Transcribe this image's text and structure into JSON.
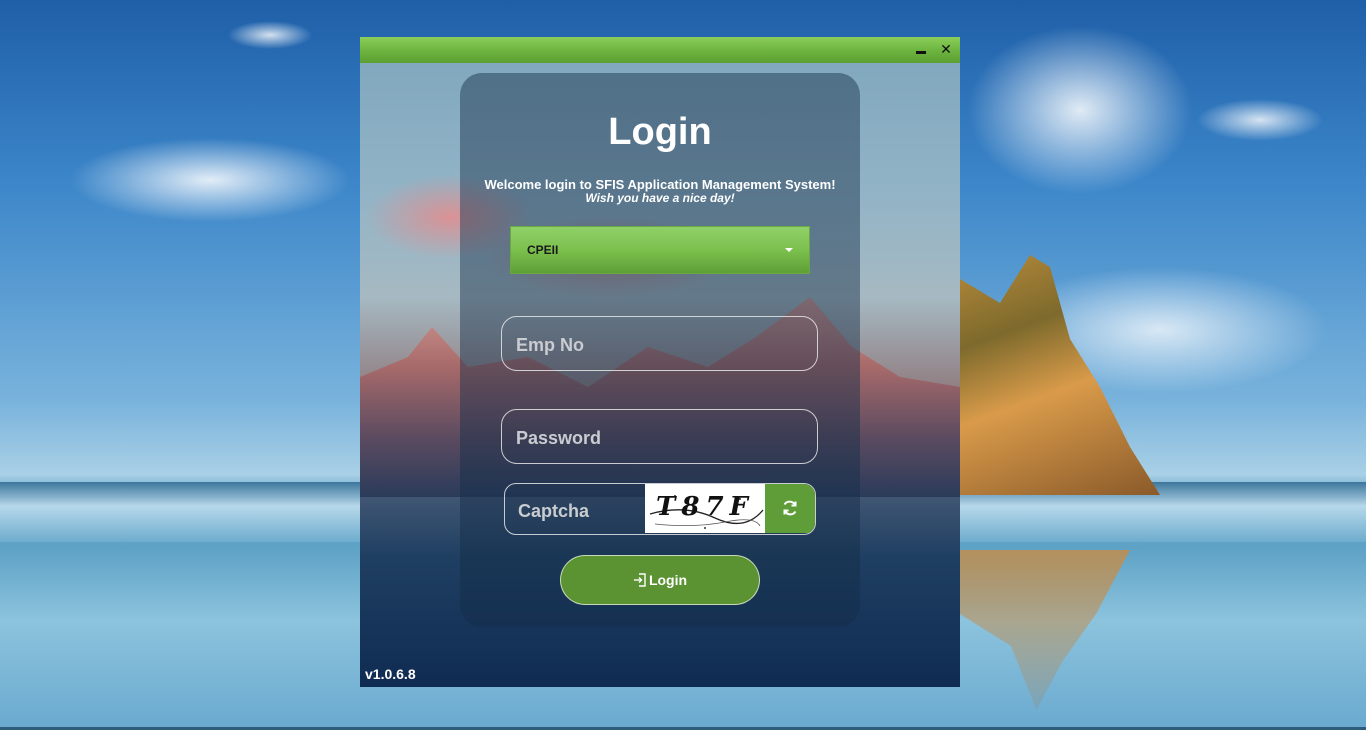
{
  "window": {
    "minimize_label": "",
    "close_label": "✕"
  },
  "login": {
    "title": "Login",
    "welcome": "Welcome login to SFIS Application Management System!",
    "wish": "Wish you have a nice day!",
    "site_select": {
      "selected": "CPEII"
    },
    "emp_no": {
      "value": "",
      "placeholder": "Emp No"
    },
    "password": {
      "value": "",
      "placeholder": "Password"
    },
    "captcha": {
      "value": "",
      "placeholder": "Captcha",
      "image_text": "T87F",
      "refresh_icon": "refresh-icon"
    },
    "submit_label": "Login",
    "submit_icon": "sign-in-icon"
  },
  "version": "v1.0.6.8",
  "colors": {
    "accent_green": "#5b9232",
    "titlebar_green": "#7cc04e"
  }
}
